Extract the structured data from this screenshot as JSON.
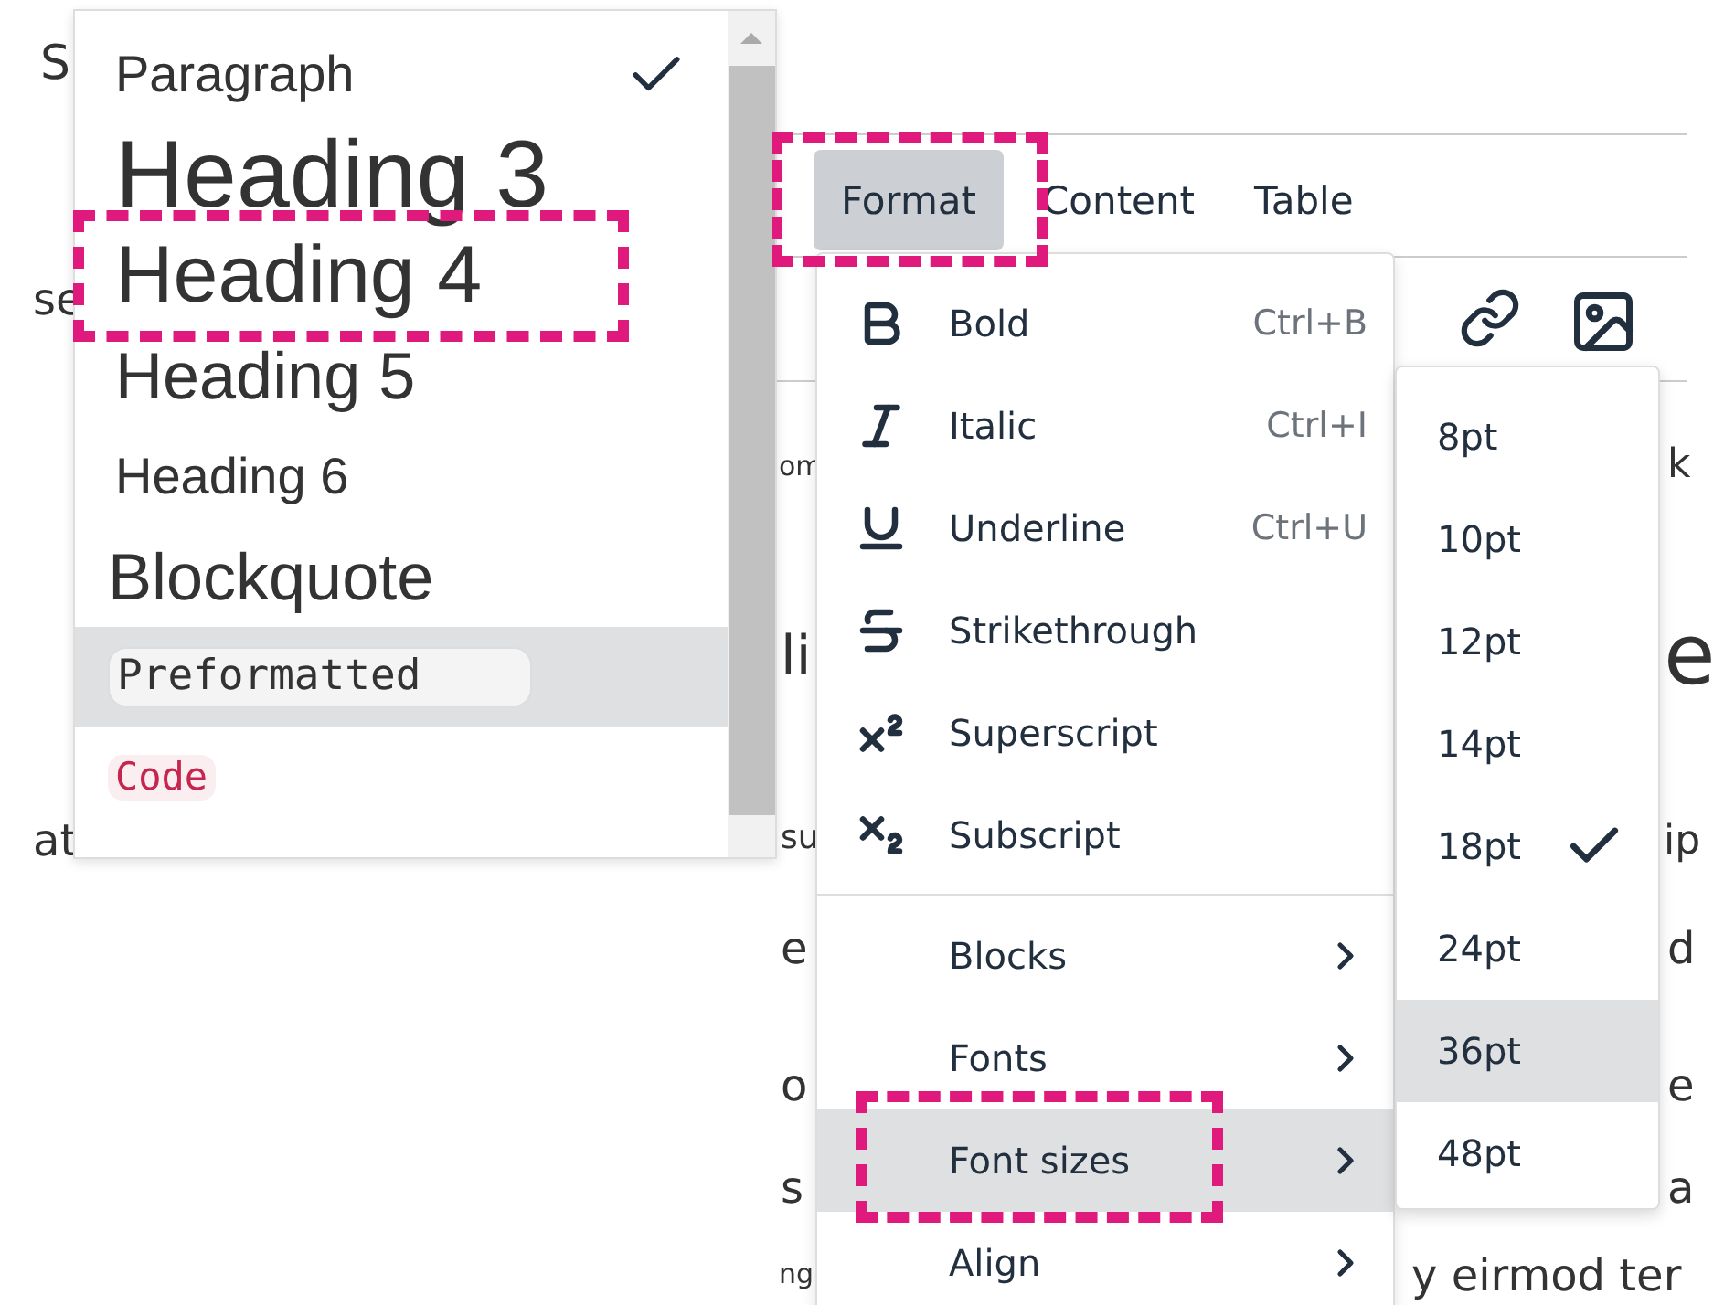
{
  "editor_fragments": [
    {
      "text": "S"
    },
    {
      "text": "se"
    },
    {
      "text": "at"
    },
    {
      "text": "om"
    },
    {
      "text": "k"
    },
    {
      "text": "li"
    },
    {
      "text": "e"
    },
    {
      "text": "su"
    },
    {
      "text": "ip"
    },
    {
      "text": "e"
    },
    {
      "text": "d"
    },
    {
      "text": "o"
    },
    {
      "text": "e"
    },
    {
      "text": "s"
    },
    {
      "text": "a"
    },
    {
      "text": "ng"
    },
    {
      "text": "y eirmod ter"
    }
  ],
  "blocks_menu": {
    "items": [
      {
        "label": "Paragraph",
        "kind": "paragraph",
        "selected": true,
        "highlighted": false
      },
      {
        "label": "Heading 3",
        "kind": "h3",
        "selected": false,
        "highlighted": false
      },
      {
        "label": "Heading 4",
        "kind": "h4",
        "selected": false,
        "highlighted": false
      },
      {
        "label": "Heading 5",
        "kind": "h5",
        "selected": false,
        "highlighted": false
      },
      {
        "label": "Heading 6",
        "kind": "h6",
        "selected": false,
        "highlighted": false
      },
      {
        "label": "Blockquote",
        "kind": "blockquote",
        "selected": false,
        "highlighted": false
      },
      {
        "label": "Preformatted",
        "kind": "pre",
        "selected": false,
        "highlighted": true
      },
      {
        "label": "Code",
        "kind": "code",
        "selected": false,
        "highlighted": false
      }
    ]
  },
  "menubar": [
    {
      "label": "Format",
      "selected": true
    },
    {
      "label": "Content",
      "selected": false
    },
    {
      "label": "Table",
      "selected": false
    }
  ],
  "format_menu": {
    "items": [
      {
        "label": "Bold",
        "kind": "format",
        "shortcut": "Ctrl+B",
        "highlighted": false
      },
      {
        "label": "Italic",
        "kind": "format",
        "shortcut": "Ctrl+I",
        "highlighted": false
      },
      {
        "label": "Underline",
        "kind": "format",
        "shortcut": "Ctrl+U",
        "highlighted": false
      },
      {
        "label": "Strikethrough",
        "kind": "format",
        "highlighted": false
      },
      {
        "label": "Superscript",
        "kind": "format",
        "highlighted": false
      },
      {
        "label": "Subscript",
        "kind": "format",
        "highlighted": false
      },
      {
        "label": "Blocks",
        "kind": "submenu",
        "highlighted": false
      },
      {
        "label": "Fonts",
        "kind": "submenu",
        "highlighted": false
      },
      {
        "label": "Font sizes",
        "kind": "submenu",
        "highlighted": true
      },
      {
        "label": "Align",
        "kind": "submenu",
        "highlighted": false
      }
    ]
  },
  "font_sizes_menu": {
    "items": [
      {
        "label": "8pt",
        "selected": false,
        "highlighted": false
      },
      {
        "label": "10pt",
        "selected": false,
        "highlighted": false
      },
      {
        "label": "12pt",
        "selected": false,
        "highlighted": false
      },
      {
        "label": "14pt",
        "selected": false,
        "highlighted": false
      },
      {
        "label": "18pt",
        "selected": true,
        "highlighted": false
      },
      {
        "label": "24pt",
        "selected": false,
        "highlighted": false
      },
      {
        "label": "36pt",
        "selected": false,
        "highlighted": true
      },
      {
        "label": "48pt",
        "selected": false,
        "highlighted": false
      }
    ]
  }
}
